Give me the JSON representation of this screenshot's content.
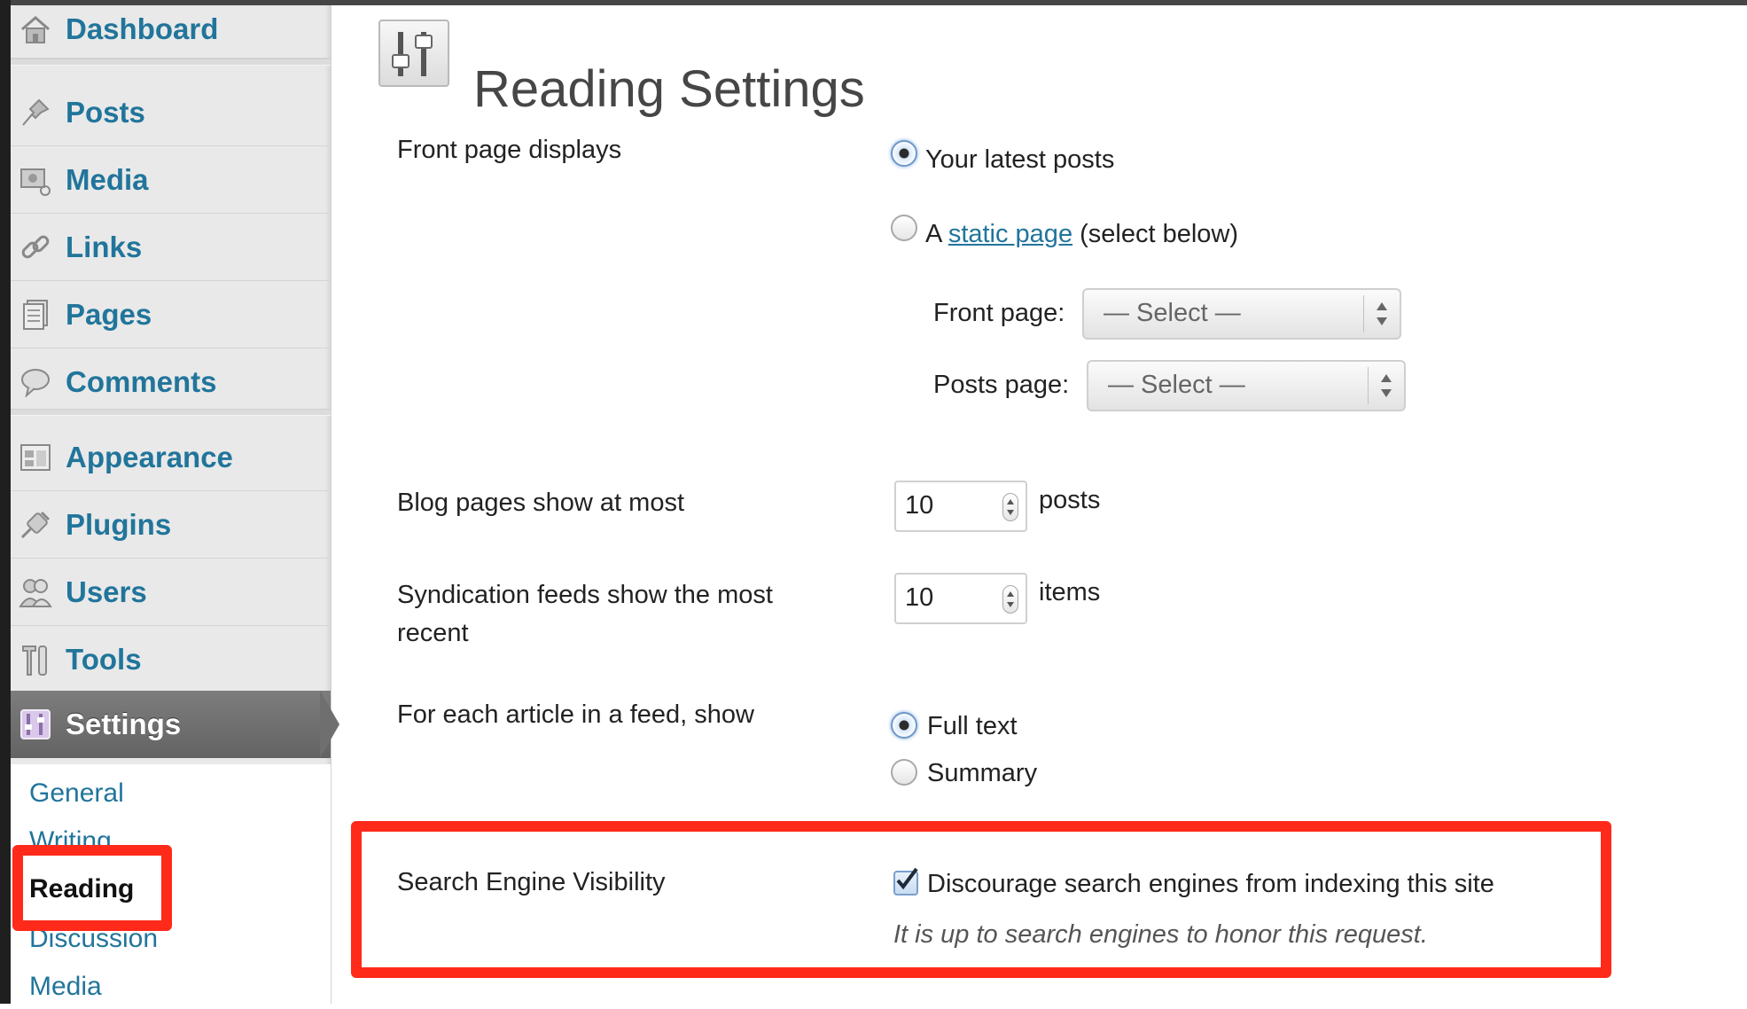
{
  "sidebar": {
    "dashboard": "Dashboard",
    "items": [
      {
        "label": "Posts",
        "icon": "pin-icon"
      },
      {
        "label": "Media",
        "icon": "media-icon"
      },
      {
        "label": "Links",
        "icon": "link-icon"
      },
      {
        "label": "Pages",
        "icon": "page-icon"
      },
      {
        "label": "Comments",
        "icon": "comment-icon"
      },
      {
        "label": "Appearance",
        "icon": "appearance-icon"
      },
      {
        "label": "Plugins",
        "icon": "plugin-icon"
      },
      {
        "label": "Users",
        "icon": "users-icon"
      },
      {
        "label": "Tools",
        "icon": "tools-icon"
      },
      {
        "label": "Settings",
        "icon": "settings-icon"
      }
    ],
    "submenu": [
      "General",
      "Writing",
      "Reading",
      "Discussion",
      "Media"
    ]
  },
  "page": {
    "title": "Reading Settings"
  },
  "front_page": {
    "label": "Front page displays",
    "option_latest": "Your latest posts",
    "option_static_prefix": "A",
    "option_static_link": "static page",
    "option_static_suffix": "(select below)",
    "front_page_label": "Front page:",
    "front_page_value": "— Select —",
    "posts_page_label": "Posts page:",
    "posts_page_value": "— Select —"
  },
  "blog_pages": {
    "label": "Blog pages show at most",
    "value": "10",
    "unit": "posts"
  },
  "syndication": {
    "label": "Syndication feeds show the most recent",
    "value": "10",
    "unit": "items"
  },
  "feed_article": {
    "label": "For each article in a feed, show",
    "option_full": "Full text",
    "option_summary": "Summary"
  },
  "visibility": {
    "label": "Search Engine Visibility",
    "checkbox_label": "Discourage search engines from indexing this site",
    "note": "It is up to search engines to honor this request."
  },
  "colors": {
    "link": "#21759b",
    "highlight": "#ff2a1a",
    "active_menu": "#6f6f6f"
  }
}
